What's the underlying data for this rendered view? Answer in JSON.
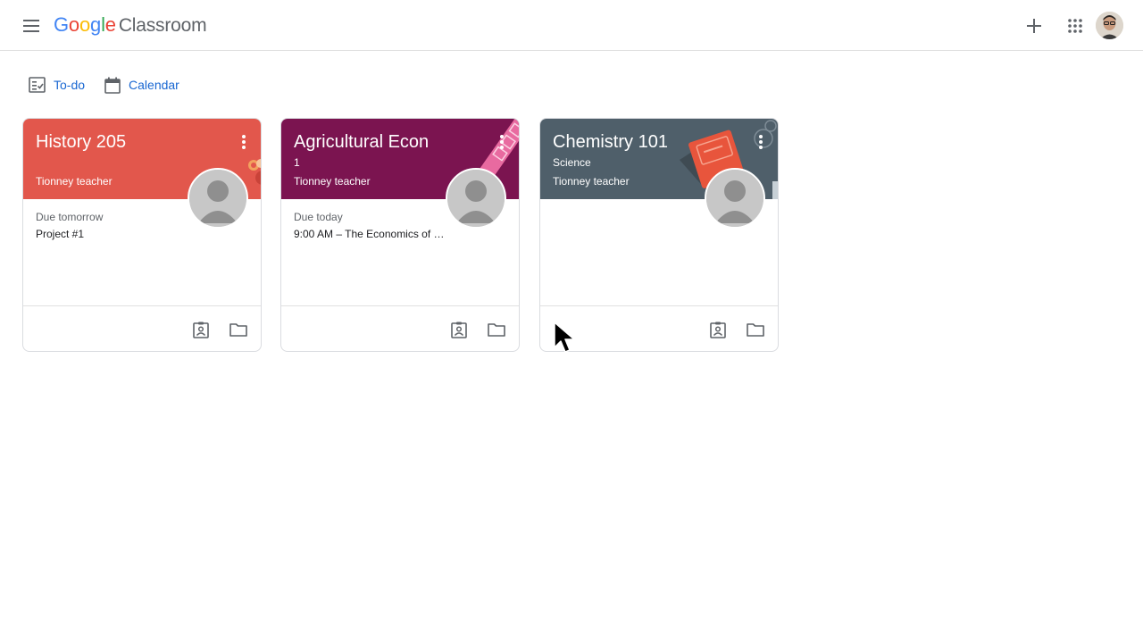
{
  "app": {
    "logo_google": [
      "G",
      "o",
      "o",
      "g",
      "l",
      "e"
    ],
    "logo_colors": [
      "#4285F4",
      "#EA4335",
      "#FBBC05",
      "#4285F4",
      "#34A853",
      "#EA4335"
    ],
    "product_name": "Classroom"
  },
  "header": {
    "icons": [
      "menu-icon",
      "plus-icon",
      "apps-grid-icon",
      "account-avatar"
    ]
  },
  "nav": {
    "todo_label": "To-do",
    "calendar_label": "Calendar",
    "link_color": "#1967d2"
  },
  "classes": [
    {
      "title": "History 205",
      "section": "",
      "teacher": "Tionney teacher",
      "due_label": "Due tomorrow",
      "due_item": "Project #1",
      "color": "#e2574c"
    },
    {
      "title": "Agricultural Econ",
      "section": "1",
      "teacher": "Tionney teacher",
      "due_label": "Due today",
      "due_item": "9:00 AM – The Economics of M...",
      "color": "#7b1450"
    },
    {
      "title": "Chemistry 101",
      "section": "Science",
      "teacher": "Tionney teacher",
      "due_label": "",
      "due_item": "",
      "color": "#4f5f6a"
    }
  ]
}
